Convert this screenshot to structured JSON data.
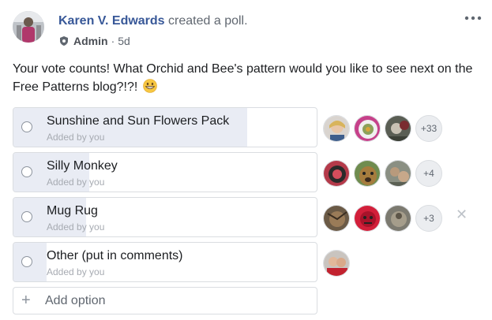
{
  "post": {
    "author": "Karen V. Edwards",
    "action": "created a poll.",
    "role": "Admin",
    "separator": "·",
    "time": "5d",
    "more_icon": "more-horizontal-icon",
    "text": "Your vote counts! What Orchid and Bee's pattern would you like to see next on the Free Patterns blog?!?!",
    "emoji_icon": "grinning-face-emoji"
  },
  "poll": {
    "options": [
      {
        "label": "Sunshine and Sun Flowers Pack",
        "sub": "Added by you",
        "vote_fraction": 0.77,
        "extra_count": "+33"
      },
      {
        "label": "Silly Monkey",
        "sub": "Added by you",
        "vote_fraction": 0.25,
        "extra_count": "+4"
      },
      {
        "label": "Mug Rug",
        "sub": "Added by you",
        "vote_fraction": 0.24,
        "extra_count": "+3",
        "remove_icon": "close-icon",
        "remove_glyph": "✕"
      },
      {
        "label": "Other (put in comments)",
        "sub": "Added by you",
        "vote_fraction": 0.11
      }
    ],
    "add_option": {
      "plus_glyph": "+",
      "placeholder": "Add option"
    }
  },
  "colors": {
    "author": "#385898",
    "poll_fill": "#e9ecf4",
    "border": "#dadde1"
  }
}
